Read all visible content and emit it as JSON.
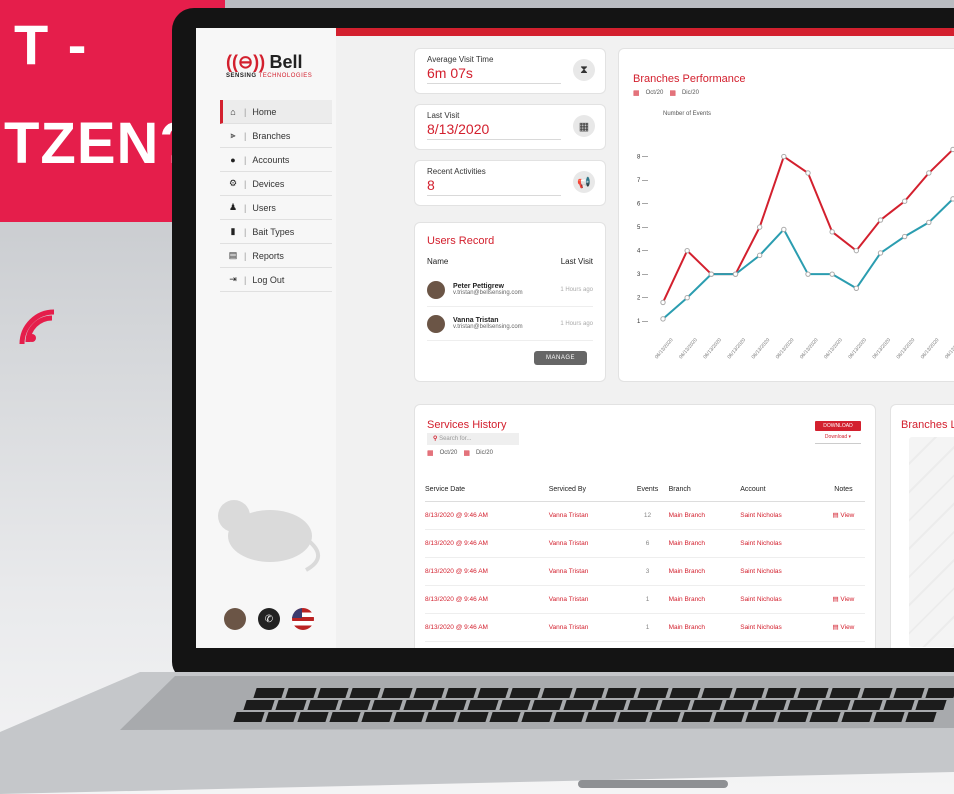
{
  "banner": {
    "line1": "T -",
    "line2": "TZEN?"
  },
  "colors": {
    "accent": "#d3202e",
    "banner": "#e51e4b",
    "teal": "#2b9db0"
  },
  "logo": {
    "bell": "Bell",
    "sensing": "SENSING",
    "tech": "TECHNOLOGIES"
  },
  "sidebar": {
    "items": [
      {
        "label": "Home",
        "icon": "home-icon"
      },
      {
        "label": "Branches",
        "icon": "branches-icon"
      },
      {
        "label": "Accounts",
        "icon": "accounts-icon"
      },
      {
        "label": "Devices",
        "icon": "devices-icon"
      },
      {
        "label": "Users",
        "icon": "users-icon"
      },
      {
        "label": "Bait Types",
        "icon": "bait-types-icon"
      },
      {
        "label": "Reports",
        "icon": "reports-icon"
      },
      {
        "label": "Log Out",
        "icon": "logout-icon"
      }
    ]
  },
  "stats": {
    "avg_label": "Average Visit Time",
    "avg_value": "6m 07s",
    "last_label": "Last Visit",
    "last_value": "8/13/2020",
    "recent_label": "Recent Activities",
    "recent_value": "8"
  },
  "users": {
    "title": "Users Record",
    "col_name": "Name",
    "col_last": "Last Visit",
    "rows": [
      {
        "name": "Peter Pettigrew",
        "email": "v.tristan@bellsensing.com",
        "last": "1 Hours ago"
      },
      {
        "name": "Vanna Tristan",
        "email": "v.tristan@bellsensing.com",
        "last": "1 Hours ago"
      }
    ],
    "manage": "MANAGE"
  },
  "chart": {
    "title": "Branches Performance",
    "from": "Oct/20",
    "to": "Dic/20"
  },
  "chart_data": {
    "type": "line",
    "ylabel": "Number of Events",
    "yticks": [
      1,
      2,
      3,
      4,
      5,
      6,
      7,
      8
    ],
    "ylim": [
      0.5,
      9
    ],
    "x": [
      "06/13/2020",
      "06/13/2020",
      "06/13/2020",
      "06/13/2020",
      "06/13/2020",
      "06/13/2020",
      "06/13/2020",
      "06/13/2020",
      "06/13/2020",
      "06/13/2020",
      "06/13/2020",
      "06/13/2020",
      "06/13/2020"
    ],
    "series": [
      {
        "color": "#d3202e",
        "values": [
          1.8,
          4,
          3,
          3,
          5,
          8,
          7.3,
          4.8,
          4,
          5.3,
          6.1,
          7.3,
          8.3
        ]
      },
      {
        "color": "#2b9db0",
        "values": [
          1.1,
          2,
          3,
          3,
          3.8,
          4.9,
          3,
          3,
          2.4,
          3.9,
          4.6,
          5.2,
          6.2
        ]
      }
    ]
  },
  "services": {
    "title": "Services History",
    "search_placeholder": "Search for...",
    "from": "Oct/20",
    "to": "Dic/20",
    "download": "DOWNLOAD",
    "download_select": "Download",
    "columns": [
      "Service Date",
      "Serviced By",
      "Events",
      "Branch",
      "Account",
      "Notes"
    ],
    "rows": [
      {
        "date": "8/13/2020 @ 9:46 AM",
        "by": "Vanna Tristan",
        "events": "12",
        "branch": "Main Branch",
        "account": "Saint Nicholas",
        "notes": "View"
      },
      {
        "date": "8/13/2020 @ 9:46 AM",
        "by": "Vanna Tristan",
        "events": "6",
        "branch": "Main Branch",
        "account": "Saint Nicholas",
        "notes": ""
      },
      {
        "date": "8/13/2020 @ 9:46 AM",
        "by": "Vanna Tristan",
        "events": "3",
        "branch": "Main Branch",
        "account": "Saint Nicholas",
        "notes": ""
      },
      {
        "date": "8/13/2020 @ 9:46 AM",
        "by": "Vanna Tristan",
        "events": "1",
        "branch": "Main Branch",
        "account": "Saint Nicholas",
        "notes": "View"
      },
      {
        "date": "8/13/2020 @ 9:46 AM",
        "by": "Vanna Tristan",
        "events": "1",
        "branch": "Main Branch",
        "account": "Saint Nicholas",
        "notes": "View"
      }
    ]
  },
  "branches_location": {
    "title": "Branches L"
  }
}
